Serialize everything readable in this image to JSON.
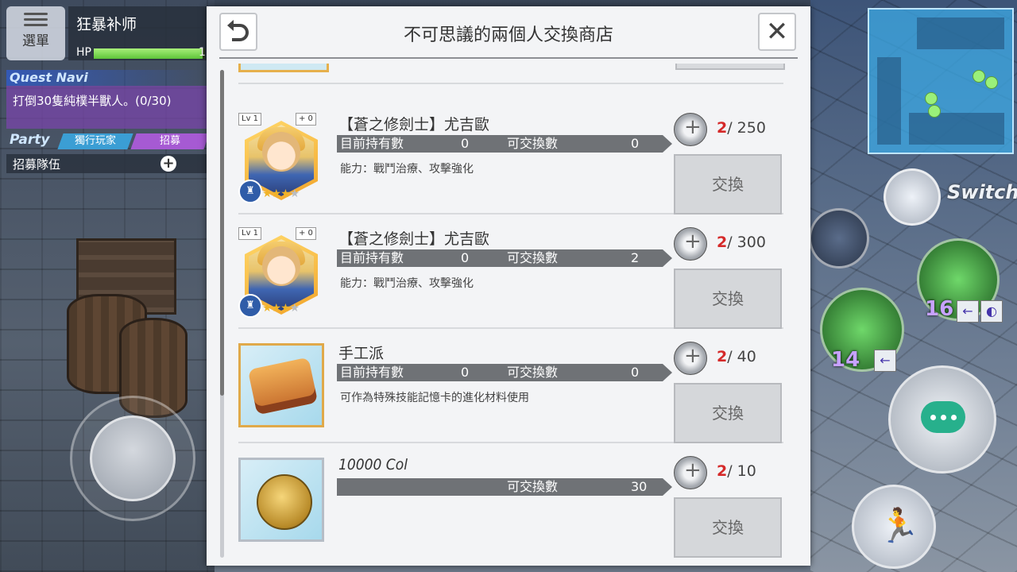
{
  "hud": {
    "menu_label": "選單",
    "player_name": "狂暴补师",
    "hp_label": "HP",
    "hp_value": "1",
    "hp_fraction": 0.98,
    "quest_title": "Quest Navi",
    "quest_text": "打倒30隻純樸半獸人。(0/30)",
    "party_label": "Party",
    "party_tab_solo": "獨行玩家",
    "party_tab_recruit": "招募",
    "recruit_team": "招募隊伍",
    "switch_label": "Switch",
    "skill_count_1": "16",
    "skill_count_2": "14"
  },
  "dialog": {
    "title": "不可思議的兩個人交換商店",
    "items": [
      {
        "name": "【蒼之修劍士】尤吉歐",
        "level": "Lv 1",
        "plus": "+ 0",
        "held_label": "目前持有數",
        "held_value": "0",
        "exch_label": "可交換數",
        "exch_value": "0",
        "description": "能力：戰鬥治療、攻擊強化",
        "cost_have": "2",
        "cost_need": "/ 250",
        "button": "交換",
        "stars": 3
      },
      {
        "name": "【蒼之修劍士】尤吉歐",
        "level": "Lv 1",
        "plus": "+ 0",
        "held_label": "目前持有數",
        "held_value": "0",
        "exch_label": "可交換數",
        "exch_value": "2",
        "description": "能力：戰鬥治療、攻擊強化",
        "cost_have": "2",
        "cost_need": "/ 300",
        "button": "交換",
        "stars": 3
      },
      {
        "name": "手工派",
        "held_label": "目前持有數",
        "held_value": "0",
        "exch_label": "可交換數",
        "exch_value": "0",
        "description": "可作為特殊技能記憶卡的進化材料使用",
        "cost_have": "2",
        "cost_need": "/ 40",
        "button": "交換"
      },
      {
        "name": "10000 Col",
        "exch_label": "可交換數",
        "exch_value": "30",
        "cost_have": "2",
        "cost_need": "/ 10",
        "button": "交換"
      }
    ]
  }
}
